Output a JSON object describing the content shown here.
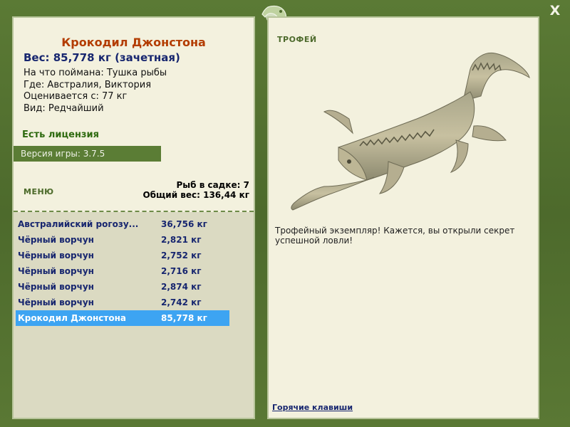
{
  "window": {
    "close_label": "X"
  },
  "fish": {
    "title": "Крокодил Джонстона",
    "weight": "Вес: 85,778 кг (зачетная)",
    "caught_on": "На что поймана: Тушка рыбы",
    "where": "Где: Австралия, Виктория",
    "valued_from": "Оценивается с: 77 кг",
    "kind": "Вид: Редчайший"
  },
  "license": "Есть лицензия",
  "version": "Версия игры: 3.7.5",
  "menu_label": "МЕНЮ",
  "stats": {
    "fish_in_cage": "Рыб в садке: 7",
    "total_weight": "Общий вес: 136,44 кг"
  },
  "catch": [
    {
      "name": "Австралийский рогозу...",
      "weight": "36,756 кг"
    },
    {
      "name": "Чёрный ворчун",
      "weight": "2,821 кг"
    },
    {
      "name": "Чёрный ворчун",
      "weight": "2,752 кг"
    },
    {
      "name": "Чёрный ворчун",
      "weight": "2,716 кг"
    },
    {
      "name": "Чёрный ворчун",
      "weight": "2,874 кг"
    },
    {
      "name": "Чёрный ворчун",
      "weight": "2,742 кг"
    },
    {
      "name": "Крокодил Джонстона",
      "weight": "85,778 кг",
      "selected": true
    }
  ],
  "trophy": {
    "label": "ТРОФЕЙ",
    "text": "Трофейный экземпляр! Кажется, вы открыли секрет успешной ловли!"
  },
  "hotkeys_label": "Горячие клавиши",
  "colors": {
    "frame": "#4f6b2e",
    "panel": "#f3f1de",
    "selected_row": "#3da4f2",
    "title": "#b33c00",
    "link": "#17266f"
  }
}
